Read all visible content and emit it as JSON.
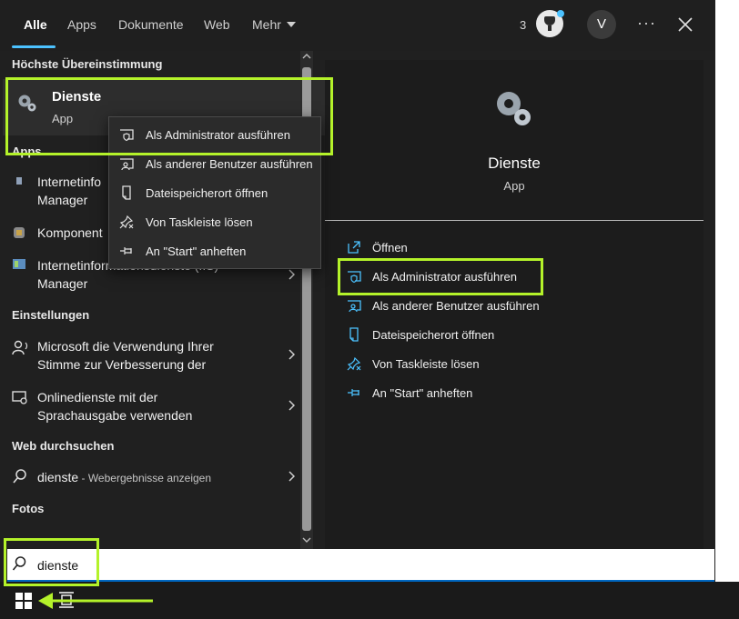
{
  "tabs": [
    {
      "label": "Alle"
    },
    {
      "label": "Apps"
    },
    {
      "label": "Dokumente"
    },
    {
      "label": "Web"
    },
    {
      "label": "Mehr"
    }
  ],
  "header": {
    "points": "3",
    "avatar_initial": "V",
    "more_label": "···"
  },
  "sections": {
    "best_match": "Höchste Übereinstimmung",
    "apps": "Apps",
    "settings": "Einstellungen",
    "web": "Web durchsuchen",
    "photos": "Fotos"
  },
  "best_match": {
    "name": "Dienste",
    "type": "App"
  },
  "apps": [
    {
      "line1": "Internetinfo",
      "line2": "Manager"
    },
    {
      "line1": "Komponent"
    },
    {
      "line1": "Internetinformationsdienste (IIS)",
      "line2": "Manager"
    }
  ],
  "settings": [
    {
      "line1": "Microsoft die Verwendung Ihrer",
      "line2": "Stimme zur Verbesserung der"
    },
    {
      "line1": "Onlinedienste mit der",
      "line2": "Sprachausgabe verwenden"
    }
  ],
  "web": {
    "query": "dienste",
    "suffix": " - Webergebnisse anzeigen"
  },
  "context_menu": [
    {
      "label": "Als Administrator ausführen",
      "icon": "shield-icon"
    },
    {
      "label": "Als anderer Benutzer ausführen",
      "icon": "user-icon"
    },
    {
      "label": "Dateispeicherort öffnen",
      "icon": "file-icon"
    },
    {
      "label": "Von Taskleiste lösen",
      "icon": "unpin-icon"
    },
    {
      "label": "An \"Start\" anheften",
      "icon": "pin-icon"
    }
  ],
  "detail": {
    "title": "Dienste",
    "subtitle": "App",
    "actions": [
      {
        "label": "Öffnen",
        "icon": "open-icon"
      },
      {
        "label": "Als Administrator ausführen",
        "icon": "shield-icon"
      },
      {
        "label": "Als anderer Benutzer ausführen",
        "icon": "user-icon"
      },
      {
        "label": "Dateispeicherort öffnen",
        "icon": "file-icon"
      },
      {
        "label": "Von Taskleiste lösen",
        "icon": "unpin-icon"
      },
      {
        "label": "An \"Start\" anheften",
        "icon": "pin-icon"
      }
    ]
  },
  "search": {
    "value": "dienste"
  },
  "colors": {
    "accent": "#4cc2ff",
    "highlight": "#b4f22a",
    "panel": "#202020"
  }
}
